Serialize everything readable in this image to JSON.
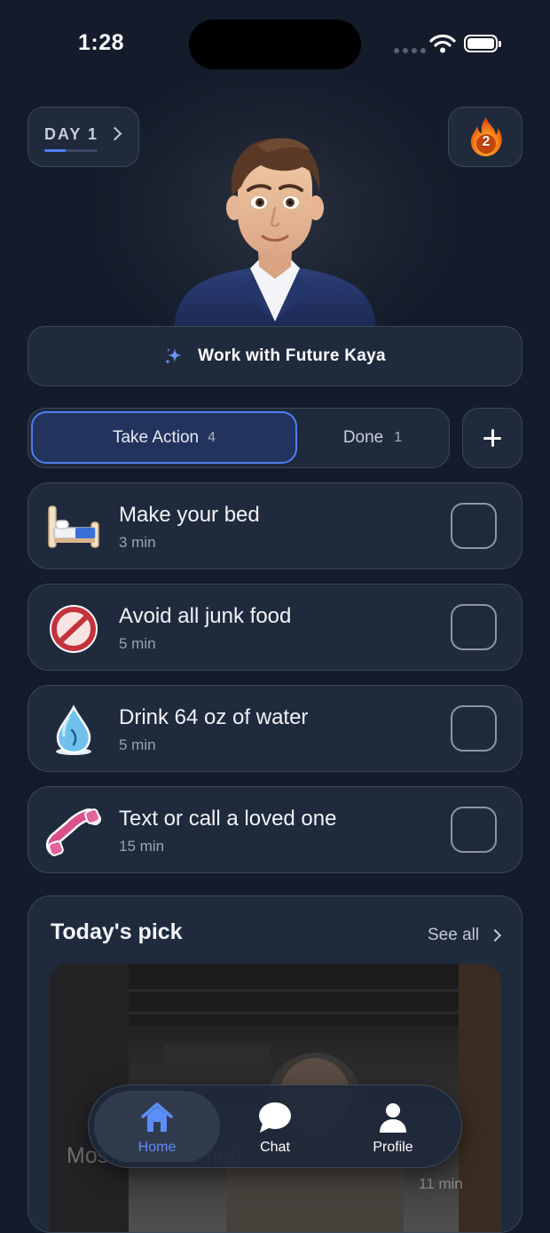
{
  "status_bar": {
    "time": "1:28"
  },
  "header": {
    "day_label": "DAY 1",
    "day_progress": 0.4,
    "streak_count": "2"
  },
  "work_button": {
    "label": "Work with Future Kaya"
  },
  "tabs": {
    "take_action": {
      "label": "Take Action",
      "count": "4"
    },
    "done": {
      "label": "Done",
      "count": "1"
    }
  },
  "tasks": [
    {
      "title": "Make your bed",
      "duration": "3 min",
      "icon": "bed-icon"
    },
    {
      "title": "Avoid all junk food",
      "duration": "5 min",
      "icon": "prohibited-icon"
    },
    {
      "title": "Drink 64 oz of water",
      "duration": "5 min",
      "icon": "water-drop-icon"
    },
    {
      "title": "Text or call a loved one",
      "duration": "15 min",
      "icon": "phone-icon"
    }
  ],
  "todays_pick": {
    "title": "Today's pick",
    "see_all": "See all",
    "media_title": "Mos… Of Women",
    "media_duration": "11 min"
  },
  "nav": {
    "home": "Home",
    "chat": "Chat",
    "profile": "Profile"
  },
  "colors": {
    "background": "#141c2b",
    "card": "#1f2a3d",
    "accent": "#4e7ef0",
    "nav_active": "#5c8ef7"
  }
}
